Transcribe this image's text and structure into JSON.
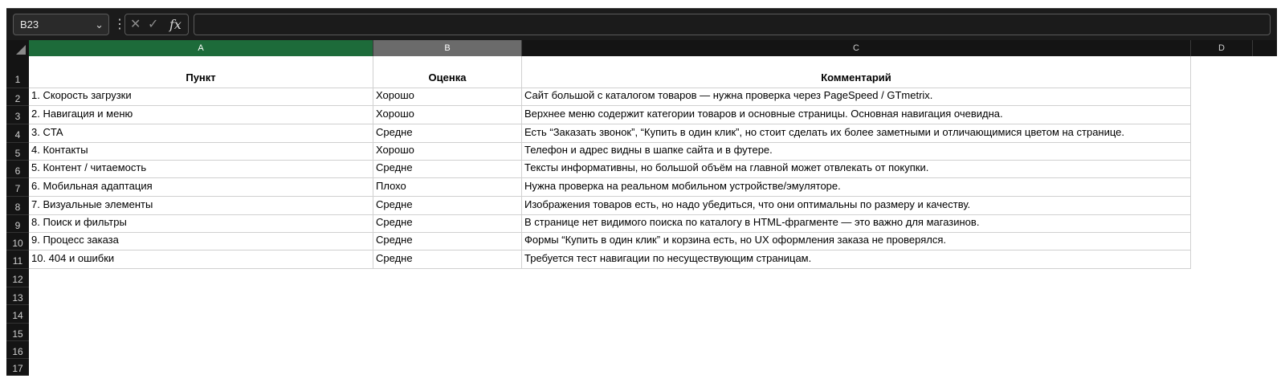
{
  "toolbar": {
    "name_box": "B23",
    "formula_value": "",
    "fx_label": "fx",
    "cancel_icon": "close-icon",
    "enter_icon": "check-icon"
  },
  "columns": [
    "A",
    "B",
    "C",
    "D"
  ],
  "rows": [
    "1",
    "2",
    "3",
    "4",
    "5",
    "6",
    "7",
    "8",
    "9",
    "10",
    "11",
    "12",
    "13",
    "14",
    "15",
    "16",
    "17"
  ],
  "colors": {
    "active_column_header": "#1d6b3a",
    "selected_column_header": "#6b6b6b",
    "chrome_bg": "#141414"
  },
  "table": {
    "headers": [
      "Пункт",
      "Оценка",
      "Комментарий"
    ],
    "rows": [
      [
        "1. Скорость загрузки",
        "Хорошо",
        "Сайт большой с каталогом товаров — нужна проверка через PageSpeed / GTmetrix."
      ],
      [
        "2. Навигация и меню",
        "Хорошо",
        "Верхнее меню содержит категории товаров и основные страницы. Основная навигация очевидна."
      ],
      [
        "3. CTA",
        "Средне",
        "Есть “Заказать звонок”, “Купить в один клик”, но стоит сделать их более заметными и отличающимися цветом на странице."
      ],
      [
        "4. Контакты",
        "Хорошо",
        "Телефон и адрес видны в шапке сайта и в футере."
      ],
      [
        "5. Контент / читаемость",
        "Средне",
        "Тексты информативны, но большой объём на главной может отвлекать от покупки."
      ],
      [
        "6. Мобильная адаптация",
        "Плохо",
        "Нужна проверка на реальном мобильном устройстве/эмуляторе."
      ],
      [
        "7. Визуальные элементы",
        "Средне",
        "Изображения товаров есть, но надо убедиться, что они оптимальны по размеру и качеству."
      ],
      [
        "8. Поиск и фильтры",
        "Средне",
        "В странице нет видимого поиска по каталогу в HTML-фрагменте — это важно для магазинов."
      ],
      [
        "9. Процесс заказа",
        "Средне",
        "Формы “Купить в один клик” и корзина есть, но UX оформления заказа не проверялся."
      ],
      [
        "10. 404 и ошибки",
        "Средне",
        "Требуется тест навигации по несуществующим страницам."
      ]
    ]
  }
}
